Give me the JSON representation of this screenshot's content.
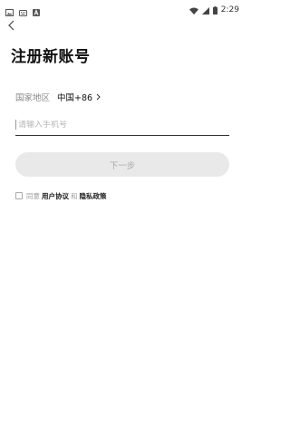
{
  "status_bar": {
    "time": "2:29",
    "icons": [
      "image-icon",
      "keyboard-icon",
      "a-app-icon",
      "wifi-icon",
      "signal-icon",
      "battery-icon"
    ]
  },
  "header": {
    "title": "注册新账号"
  },
  "region": {
    "label": "国家地区",
    "value": "中国+86"
  },
  "phone": {
    "placeholder": "请输入手机号",
    "value": ""
  },
  "next_button": {
    "label": "下一步"
  },
  "agreement": {
    "prefix": "同意",
    "user_agreement": "用户协议",
    "conjunction": "和",
    "privacy_policy": "隐私政策"
  },
  "colors": {
    "background": "#ffffff",
    "button_disabled_bg": "#e9e9e9",
    "button_disabled_text": "#aaaaaa",
    "muted_text": "#888888",
    "underline": "#333333"
  }
}
